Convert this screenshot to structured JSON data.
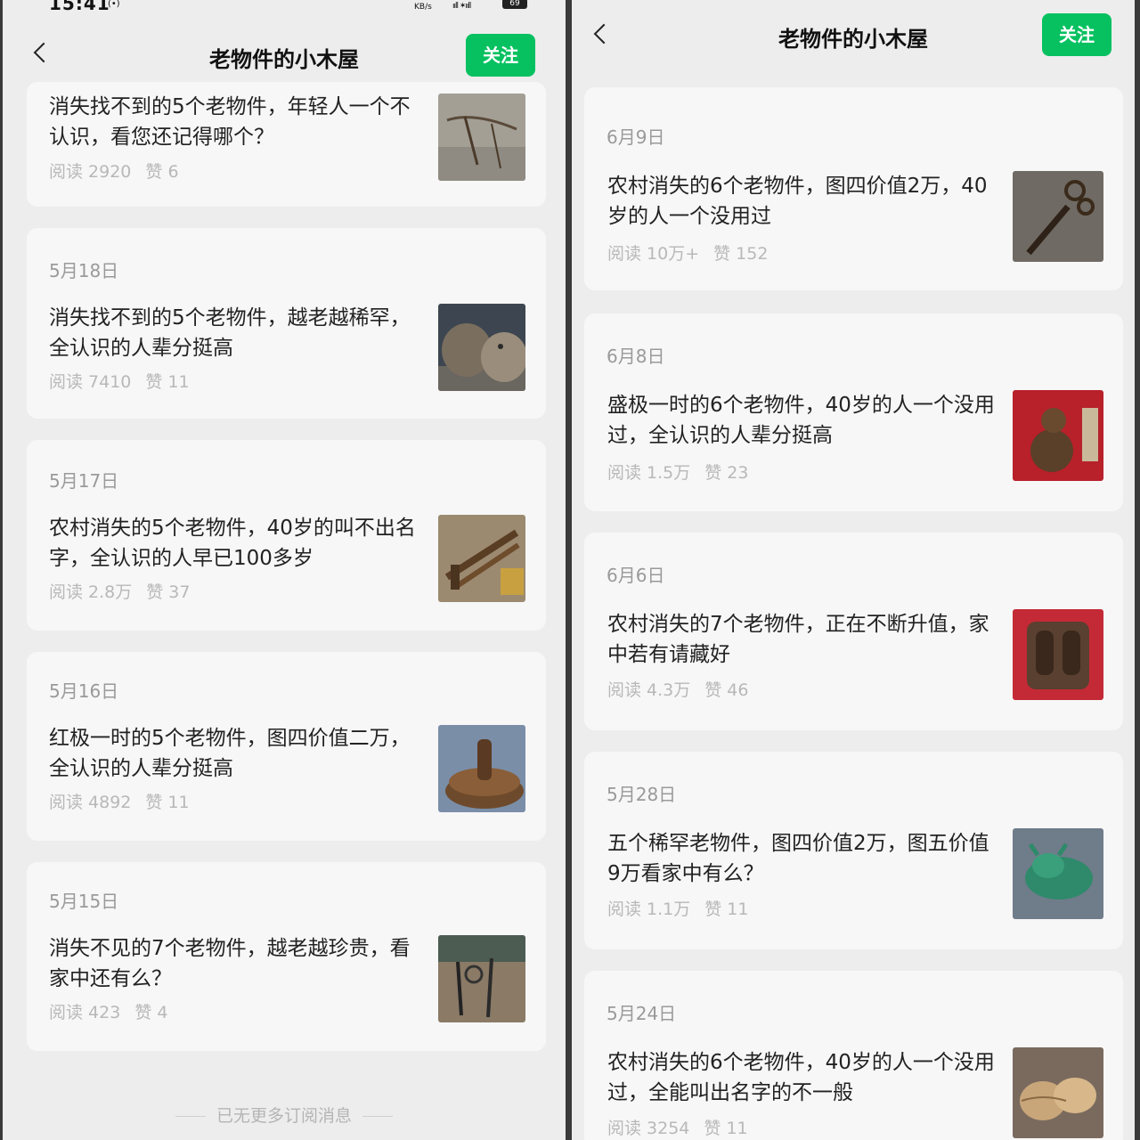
{
  "left": {
    "status": {
      "time": "15:41",
      "net": "(•)",
      "speed": "KB/s",
      "signal": "ııll ✶ııll",
      "battery": "69"
    },
    "header": {
      "title": "老物件的小木屋",
      "follow": "关注"
    },
    "articles": [
      {
        "date": "",
        "title": "消失找不到的5个老物件，年轻人一个不认识，看您还记得哪个？",
        "reads": "阅读 2920",
        "likes": "赞 6"
      },
      {
        "date": "5月18日",
        "title": "消失找不到的5个老物件，越老越稀罕，全认识的人辈分挺高",
        "reads": "阅读 7410",
        "likes": "赞 11"
      },
      {
        "date": "5月17日",
        "title": "农村消失的5个老物件，40岁的叫不出名字，全认识的人早已100多岁",
        "reads": "阅读 2.8万",
        "likes": "赞 37"
      },
      {
        "date": "5月16日",
        "title": "红极一时的5个老物件，图四价值二万，全认识的人辈分挺高",
        "reads": "阅读 4892",
        "likes": "赞 11"
      },
      {
        "date": "5月15日",
        "title": "消失不见的7个老物件，越老越珍贵，看家中还有么？",
        "reads": "阅读 423",
        "likes": "赞 4"
      }
    ],
    "footer": "已无更多订阅消息"
  },
  "right": {
    "header": {
      "title": "老物件的小木屋",
      "follow": "关注"
    },
    "articles": [
      {
        "date": "6月9日",
        "title": "农村消失的6个老物件，图四价值2万，40岁的人一个没用过",
        "reads": "阅读 10万+",
        "likes": "赞 152"
      },
      {
        "date": "6月8日",
        "title": "盛极一时的6个老物件，40岁的人一个没用过，全认识的人辈分挺高",
        "reads": "阅读 1.5万",
        "likes": "赞 23"
      },
      {
        "date": "6月6日",
        "title": "农村消失的7个老物件，正在不断升值，家中若有请藏好",
        "reads": "阅读 4.3万",
        "likes": "赞 46"
      },
      {
        "date": "5月28日",
        "title": "五个稀罕老物件，图四价值2万，图五价值9万看家中有么？",
        "reads": "阅读 1.1万",
        "likes": "赞 11"
      },
      {
        "date": "5月24日",
        "title": "农村消失的6个老物件，40岁的人一个没用过，全能叫出名字的不一般",
        "reads": "阅读 3254",
        "likes": "赞 11"
      }
    ]
  },
  "colors": {
    "accent": "#07c160",
    "background": "#ededed",
    "card": "#f7f7f7"
  }
}
